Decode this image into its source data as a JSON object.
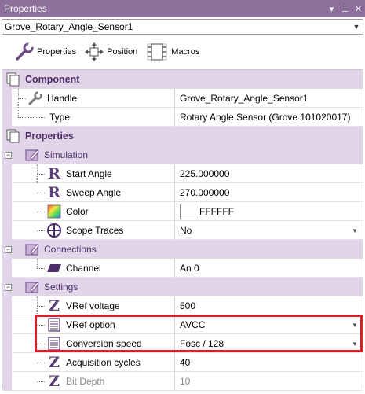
{
  "window": {
    "title": "Properties",
    "controls": [
      "▾",
      "⊥",
      "✕"
    ]
  },
  "selector": {
    "value": "Grove_Rotary_Angle_Sensor1"
  },
  "toolbar": {
    "properties_label": "Properties",
    "position_label": "Position",
    "macros_label": "Macros"
  },
  "component": {
    "title": "Component",
    "handle_label": "Handle",
    "handle_value": "Grove_Rotary_Angle_Sensor1",
    "type_label": "Type",
    "type_value": "Rotary Angle Sensor (Grove 101020017)"
  },
  "properties": {
    "title": "Properties",
    "simulation": {
      "title": "Simulation",
      "start_angle_label": "Start Angle",
      "start_angle_value": "225.000000",
      "sweep_angle_label": "Sweep Angle",
      "sweep_angle_value": "270.000000",
      "color_label": "Color",
      "color_value": "FFFFFF",
      "scope_traces_label": "Scope Traces",
      "scope_traces_value": "No"
    },
    "connections": {
      "title": "Connections",
      "channel_label": "Channel",
      "channel_value": "An 0"
    },
    "settings": {
      "title": "Settings",
      "vref_voltage_label": "VRef voltage",
      "vref_voltage_value": "500",
      "vref_option_label": "VRef option",
      "vref_option_value": "AVCC",
      "conversion_speed_label": "Conversion speed",
      "conversion_speed_value": "Fosc / 128",
      "acquisition_cycles_label": "Acquisition cycles",
      "acquisition_cycles_value": "40",
      "bit_depth_label": "Bit Depth",
      "bit_depth_value": "10"
    }
  },
  "colors": {
    "title_bar": "#8d6f9b",
    "category_bg": "#e2d5e9",
    "category_text": "#4b2d68",
    "highlight": "#d8202a"
  }
}
